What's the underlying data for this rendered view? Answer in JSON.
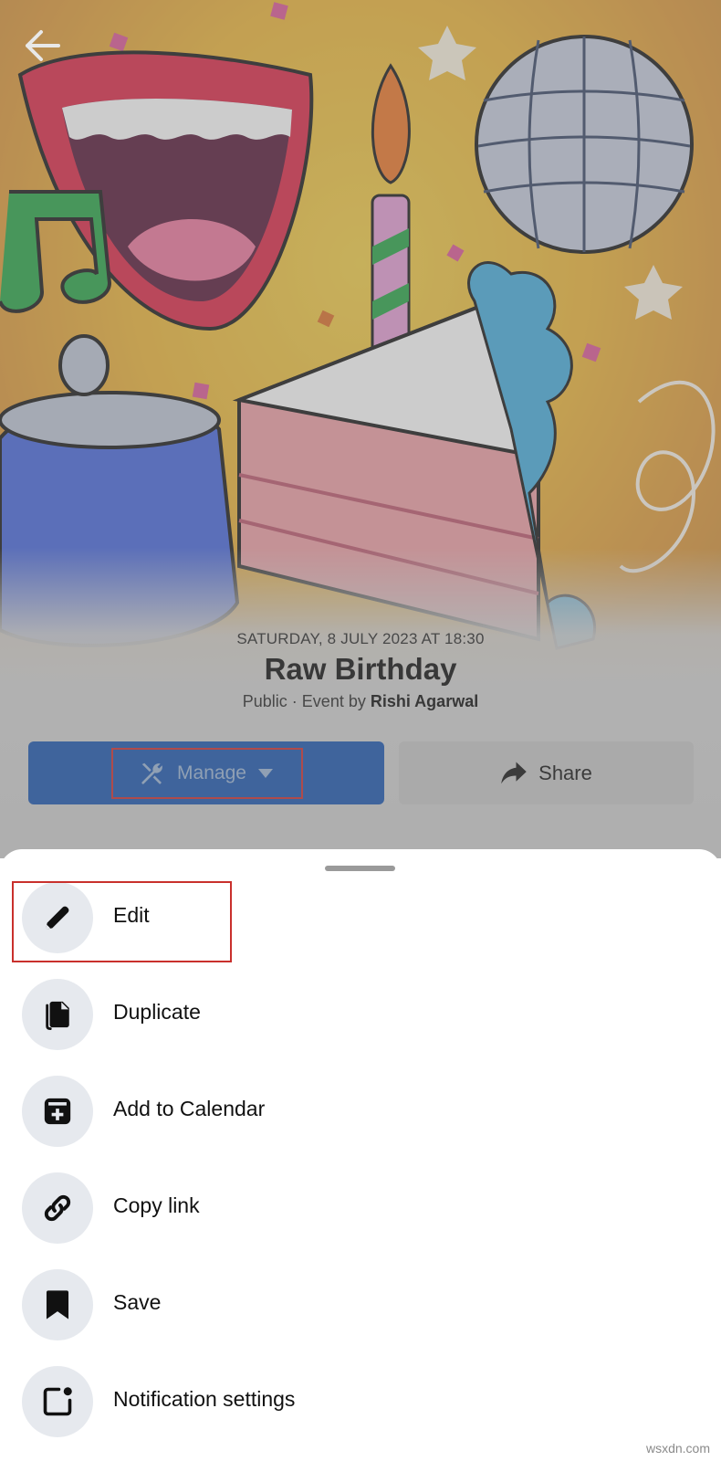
{
  "event": {
    "date": "SATURDAY, 8 JULY 2023 AT 18:30",
    "title": "Raw Birthday",
    "privacy_prefix": "Public · Event by ",
    "host": "Rishi Agarwal"
  },
  "actions": {
    "manage_label": "Manage",
    "share_label": "Share"
  },
  "menu": {
    "items": [
      {
        "label": "Edit",
        "icon": "pencil-icon"
      },
      {
        "label": "Duplicate",
        "icon": "copy-icon"
      },
      {
        "label": "Add to Calendar",
        "icon": "calendar-plus-icon"
      },
      {
        "label": "Copy link",
        "icon": "link-icon"
      },
      {
        "label": "Save",
        "icon": "bookmark-icon"
      },
      {
        "label": "Notification settings",
        "icon": "notification-icon"
      }
    ]
  },
  "watermark": "wsxdn.com",
  "colors": {
    "primary": "#1c58b2",
    "highlight": "#d1302f",
    "icon_bg": "#e6e9ee"
  }
}
